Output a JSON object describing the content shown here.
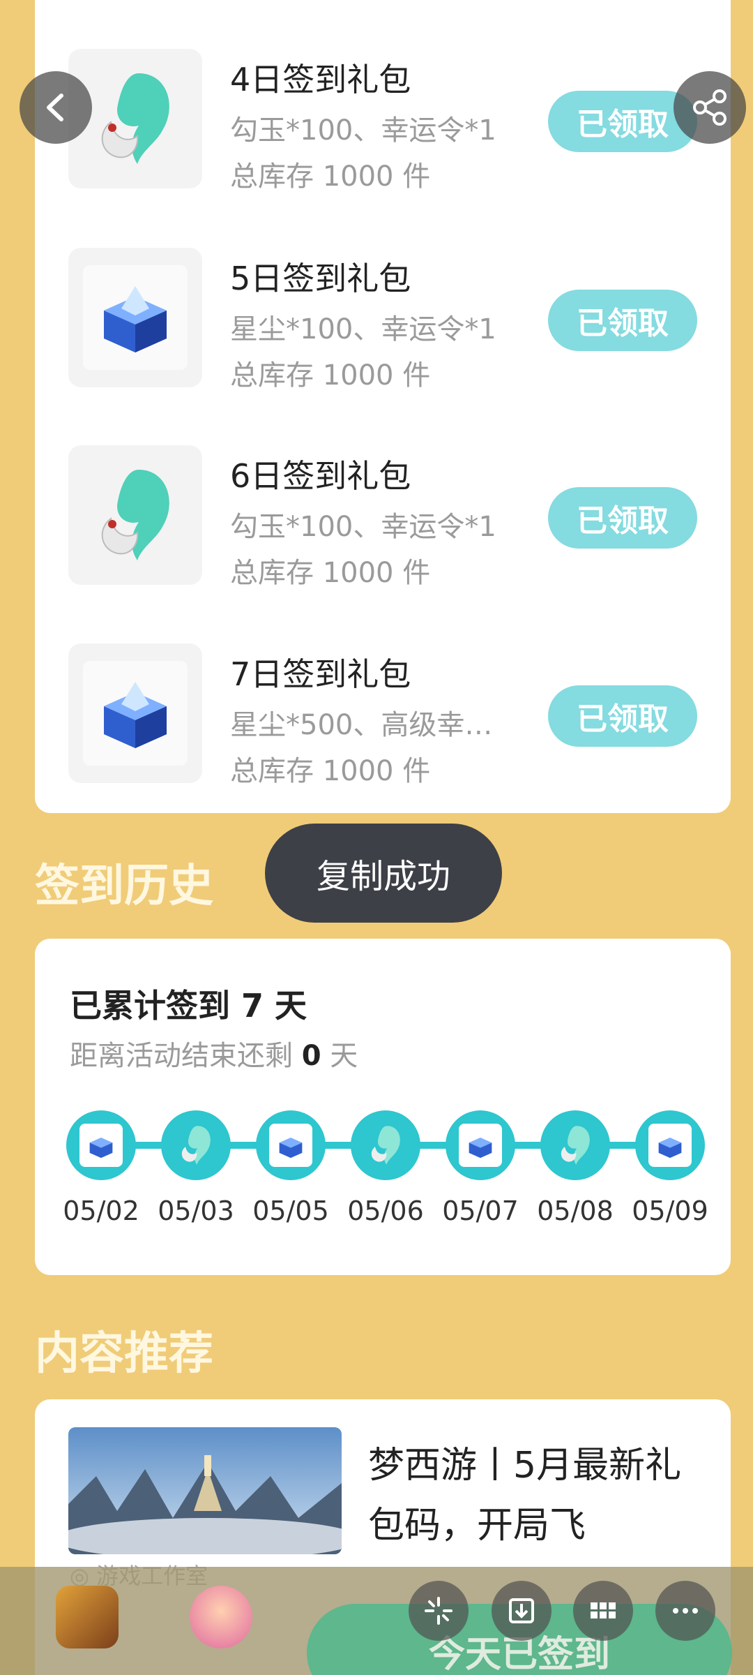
{
  "gifts": [
    {
      "title": "4日签到礼包",
      "desc": "勾玉*100、幸运令*1",
      "stock": "总库存 1000 件",
      "button": "已领取",
      "icon": "jade-magatama-icon"
    },
    {
      "title": "5日签到礼包",
      "desc": "星尘*100、幸运令*1",
      "stock": "总库存 1000 件",
      "button": "已领取",
      "icon": "blue-crystal-chest-icon"
    },
    {
      "title": "6日签到礼包",
      "desc": "勾玉*100、幸运令*1",
      "stock": "总库存 1000 件",
      "button": "已领取",
      "icon": "jade-magatama-icon"
    },
    {
      "title": "7日签到礼包",
      "desc": "星尘*500、高级幸…",
      "stock": "总库存 1000 件",
      "button": "已领取",
      "icon": "blue-crystal-chest-icon"
    }
  ],
  "history": {
    "section_title": "签到历史",
    "total_prefix": "已累计签到 ",
    "total_days": "7",
    "total_suffix": " 天",
    "remain_prefix": "距离活动结束还剩 ",
    "remain_days": "0",
    "remain_suffix": " 天",
    "dates": [
      "05/02",
      "05/03",
      "05/05",
      "05/06",
      "05/07",
      "05/08",
      "05/09"
    ]
  },
  "toast": "复制成功",
  "recommend": {
    "section_title": "内容推荐",
    "title": "梦西游丨5月最新礼包码，开局飞",
    "meta": "◎ 游戏工作室"
  },
  "bottom": {
    "signed_button": "今天已签到"
  },
  "colors": {
    "background": "#f0cc78",
    "accent": "#2ec6cf",
    "claimed_button": "#84dbe0",
    "toast": "#3e4048"
  }
}
